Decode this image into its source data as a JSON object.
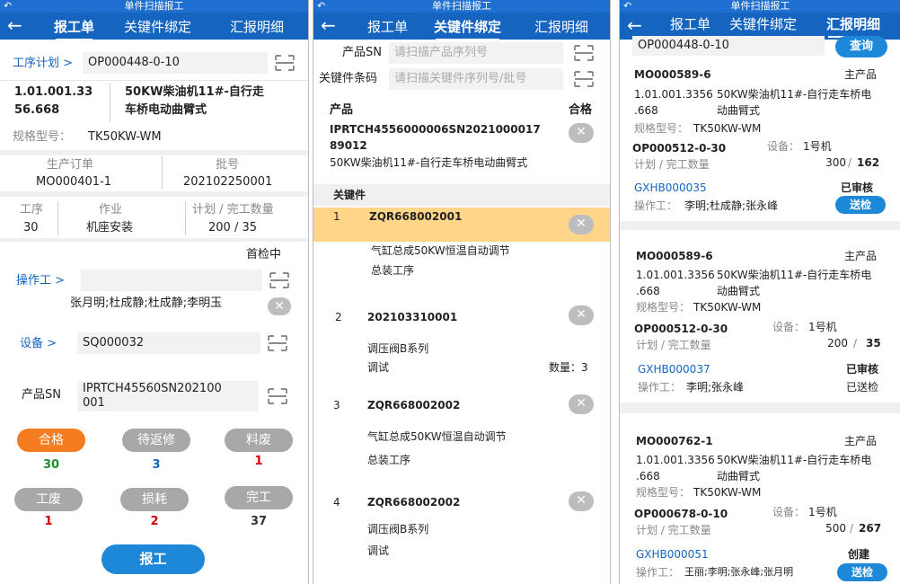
{
  "titlebar_title": "单件扫描报工",
  "tabs": [
    "报工单",
    "关键件绑定",
    "汇报明细"
  ],
  "icons": {
    "back": "back-arrow-icon",
    "scan": "scan-icon",
    "clear": "clear-icon"
  },
  "colors": {
    "header": "#1565c0",
    "titlebar": "#1f6fd0",
    "ok": "#f57c1f",
    "pill": "#a8a8a8"
  },
  "p1": {
    "process_plan_label": "工序计划 >",
    "process_plan_value": "OP000448-0-10",
    "material_code_1": "1.01.001.33",
    "material_code_2": "56.668",
    "material_name_1": "50KW柴油机11#-自行走",
    "material_name_2": "车桥电动曲臂式",
    "spec_label": "规格型号：",
    "spec_value": "TK50KW-WM",
    "prod_order_label": "生产订单",
    "prod_order_value": "MO000401-1",
    "batch_label": "批号",
    "batch_value": "202102250001",
    "step_label": "工序",
    "step_value": "30",
    "work_label": "作业",
    "work_value": "机座安装",
    "plan_label": "计划 / 完工数量",
    "plan_value": "200 / 35",
    "first_check": "首检中",
    "operator_label": "操作工 >",
    "operator_placeholder": "",
    "operator_names": "张月明;杜成静;杜成静;李明玉",
    "device_label": "设备 >",
    "device_value": "SQ000032",
    "sn_label": "产品SN",
    "sn_value_1": "IPRTCH45560SN202100",
    "sn_value_2": "001",
    "pills": [
      {
        "label": "合格",
        "count": "30",
        "count_color": "#1a8f2a"
      },
      {
        "label": "待返修",
        "count": "3",
        "count_color": "#1565c0"
      },
      {
        "label": "料废",
        "count": "1",
        "count_color": "#d50000"
      },
      {
        "label": "工废",
        "count": "1",
        "count_color": "#d50000"
      },
      {
        "label": "损耗",
        "count": "2",
        "count_color": "#d50000"
      },
      {
        "label": "完工",
        "count": "37",
        "count_color": "#333333"
      }
    ],
    "report_button": "报工"
  },
  "p2": {
    "sn_label": "产品SN",
    "sn_placeholder": "请扫描产品序列号",
    "kp_label": "关键件条码",
    "kp_placeholder": "请扫描关键件序列号/批号",
    "product_header": "产品",
    "qualified_header": "合格",
    "product_code_1": "IPRTCH4556000006SN2021000017",
    "product_code_2": "89012",
    "product_name": "50KW柴油机11#-自行走车桥电动曲臂式",
    "keyparts_header": "关键件",
    "items": [
      {
        "no": "1",
        "code": "ZQR668002001",
        "name": "气缸总成50KW恒温自动调节",
        "desc": "总装工序",
        "qty": ""
      },
      {
        "no": "2",
        "code": "202103310001",
        "name": "调压阀B系列",
        "desc": "调试",
        "qty": "数量：3"
      },
      {
        "no": "3",
        "code": "ZQR668002002",
        "name": "气缸总成50KW恒温自动调节",
        "desc": "总装工序",
        "qty": ""
      },
      {
        "no": "4",
        "code": "ZQR668002002",
        "name": "调压阀B系列",
        "desc": "调试",
        "qty": ""
      }
    ]
  },
  "p3": {
    "search_value": "OP000448-0-10",
    "query_button": "查询",
    "cards": [
      {
        "mo": "MO000589-6",
        "tag": "主产品",
        "code_1": "1.01.001.3356",
        "code_2": ".668",
        "name_1": "50KW柴油机11#-自行走车桥电",
        "name_2": "动曲臂式",
        "spec_label": "规格型号：",
        "spec": "TK50KW-WM",
        "op": "OP000512-0-30",
        "device_label": "设备：",
        "device": "1号机",
        "plan_label": "计划 / 完工数量",
        "plan": "300",
        "done": "162",
        "rpt": "GXHB000035",
        "status": "已审核",
        "op_label": "操作工：",
        "ops": "李明;杜成静;张永峰",
        "action": "送检",
        "action_type": "button"
      },
      {
        "mo": "MO000589-6",
        "tag": "主产品",
        "code_1": "1.01.001.3356",
        "code_2": ".668",
        "name_1": "50KW柴油机11#-自行走车桥电",
        "name_2": "动曲臂式",
        "spec_label": "规格型号：",
        "spec": "TK50KW-WM",
        "op": "OP000512-0-30",
        "device_label": "设备：",
        "device": "1号机",
        "plan_label": "计划 / 完工数量",
        "plan": "200",
        "done": "35",
        "rpt": "GXHB000037",
        "status": "已审核",
        "op_label": "操作工：",
        "ops": "李明;张永峰",
        "action": "已送检",
        "action_type": "text"
      },
      {
        "mo": "MO000762-1",
        "tag": "主产品",
        "code_1": "1.01.001.3356",
        "code_2": ".668",
        "name_1": "50KW柴油机11#-自行走车桥电",
        "name_2": "动曲臂式",
        "spec_label": "规格型号：",
        "spec": "TK50KW-WM",
        "op": "OP000678-0-10",
        "device_label": "设备：",
        "device": "1号机",
        "plan_label": "计划 / 完工数量",
        "plan": "500",
        "done": "267",
        "rpt": "GXHB000051",
        "status": "创建",
        "op_label": "操作工：",
        "ops": "王丽;李明;张永峰;张月明",
        "action": "送检",
        "action_type": "button"
      }
    ]
  }
}
